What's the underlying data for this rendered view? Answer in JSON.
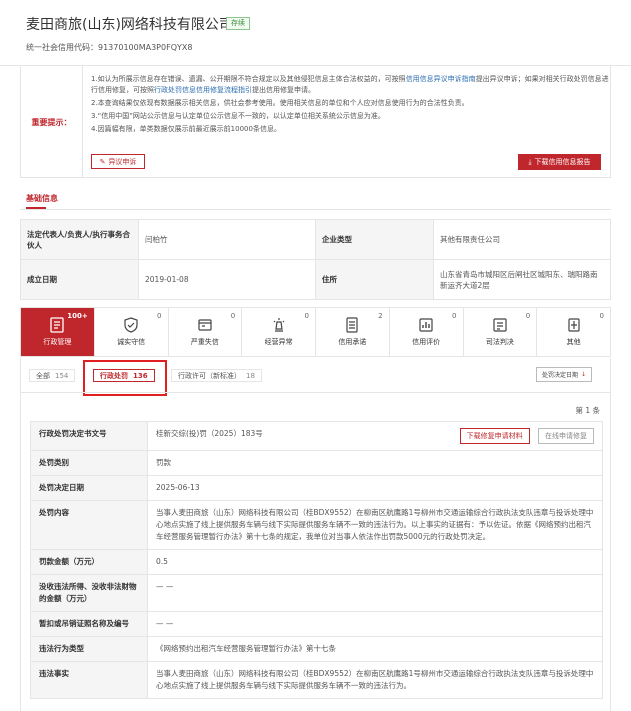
{
  "header": {
    "company_name": "麦田商旅(山东)网络科技有限公司",
    "status": "存续",
    "credit_code": "统一社会信用代码：91370100MA3P0FQYX8"
  },
  "notice": {
    "label": "重要提示：",
    "line1_a": "1.如认为所展示信息存在错误、遗漏、公开期限不符合规定以及其他侵犯信息主体合法权益的，可按照",
    "line1_link": "信用信息异议申诉指南",
    "line1_b": "提出异议申诉；如果对相关行政处罚信息进行信用修复，可按照",
    "line1_link2": "行政处罚信息信用修复流程指引",
    "line1_c": "提出信用修复申请。",
    "line2": "2.本查询结果仅依现有数据展示相关信息，供社会参考使用。使用相关信息的单位和个人应对信息使用行为的合法性负责。",
    "line3": "3.“信用中国”网站公示信息与认定单位公示信息不一致的，以认定单位相关系统公示信息为准。",
    "line4": "4.因篇幅有限，单类数据仅展示前最近展示前10000条信息。",
    "appeal_label": "异议申诉",
    "download_label": "下载信用信息报告"
  },
  "basic": {
    "title": "基础信息",
    "legal_rep_key": "法定代表人/负责人/执行事务合伙人",
    "legal_rep_val": "闫柏竹",
    "company_type_key": "企业类型",
    "company_type_val": "其他有限责任公司",
    "established_key": "成立日期",
    "established_val": "2019-01-08",
    "address_key": "住所",
    "address_val": "山东省青岛市城阳区后闸社区城阳东、瑞阳路南新运齐大道2层"
  },
  "categories": [
    {
      "label": "行政管理",
      "count": "100+",
      "icon": "admin-icon"
    },
    {
      "label": "诚实守信",
      "count": "0",
      "icon": "honesty-icon"
    },
    {
      "label": "严重失信",
      "count": "0",
      "icon": "dishonest-icon"
    },
    {
      "label": "经营异常",
      "count": "0",
      "icon": "abnormal-icon"
    },
    {
      "label": "信用承诺",
      "count": "2",
      "icon": "promise-icon"
    },
    {
      "label": "信用评价",
      "count": "0",
      "icon": "evaluation-icon"
    },
    {
      "label": "司法判决",
      "count": "0",
      "icon": "judicial-icon"
    },
    {
      "label": "其他",
      "count": "0",
      "icon": "other-icon"
    }
  ],
  "filters": {
    "all_label": "全部",
    "all_count": "154",
    "penalty_label": "行政处罚",
    "penalty_count": "136",
    "license_label": "行政许可（新标准）",
    "license_count": "18",
    "sort_label": "处罚决定日期"
  },
  "detail": {
    "page_count": "第 1 条",
    "doc_no_key": "行政处罚决定书文号",
    "doc_no_val": "桂新交综(投)罚（2025）183号",
    "btn_download_repair": "下载修复申请材料",
    "btn_online_repair": "在线申请修复",
    "category_key": "处罚类别",
    "category_val": "罚款",
    "date_key": "处罚决定日期",
    "date_val": "2025-06-13",
    "content_key": "处罚内容",
    "content_val": "当事人麦田商旅（山东）网络科技有限公司（桂BDX9552）在柳南区航鹰路1号柳州市交通运输综合行政执法支队违章与投诉处理中心地点实施了线上提供服务车辆与线下实际提供服务车辆不一致的违法行为。以上事实的证据有：予以佐证。依据《网络预约出租汽车经营服务管理暂行办法》第十七条的规定，我单位对当事人依法作出罚款5000元的行政处罚决定。",
    "amount_key": "罚款金额（万元）",
    "amount_val": "0.5",
    "confiscate_key": "没收违法所得、没收非法财物的金额（万元）",
    "confiscate_val": "— —",
    "license_revoke_key": "暂扣或吊销证照名称及编号",
    "license_revoke_val": "— —",
    "violation_type_key": "违法行为类型",
    "violation_type_val": "《网络预约出租汽车经营服务管理暂行办法》第十七条",
    "facts_key": "违法事实",
    "facts_val": "当事人麦田商旅（山东）网络科技有限公司（桂BDX9552）在柳南区航鹰路1号柳州市交通运输综合行政执法支队违章与投诉处理中心地点实施了线上提供服务车辆与线下实际提供服务车辆不一致的违法行为。"
  },
  "colors": {
    "accent": "#c0272d",
    "status_green": "#3c8a3c"
  }
}
